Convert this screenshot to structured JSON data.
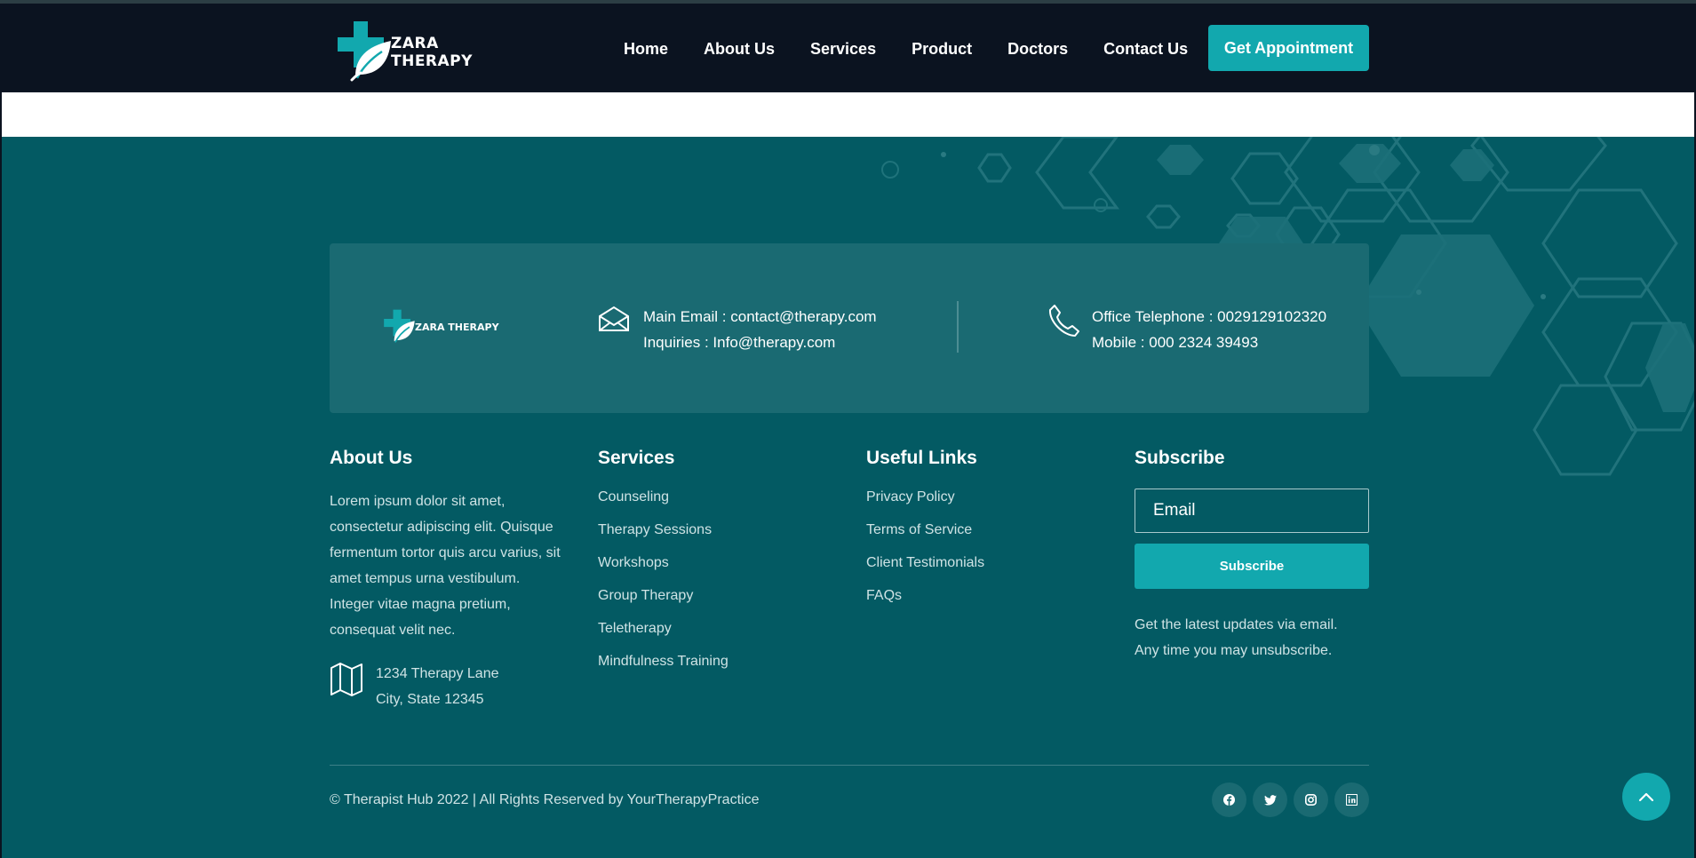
{
  "brand": {
    "name": "ZARA THERAPY",
    "accent_color": "#12a8ae",
    "nav_bg": "#0b1320",
    "footer_bg": "#035a63"
  },
  "nav": {
    "items": [
      {
        "label": "Home"
      },
      {
        "label": "About Us"
      },
      {
        "label": "Services"
      },
      {
        "label": "Product"
      },
      {
        "label": "Doctors"
      },
      {
        "label": "Contact Us"
      }
    ],
    "cta_label": "Get Appointment"
  },
  "contact": {
    "logo_text": "ZARA THERAPY",
    "mail_icon": "envelope-icon",
    "main_email": "Main Email : contact@therapy.com",
    "inquiries": "Inquiries : Info@therapy.com",
    "phone_icon": "phone-icon",
    "office_phone": "Office Telephone : 0029129102320",
    "mobile": "Mobile : 000 2324 39493"
  },
  "about": {
    "heading": "About Us",
    "text": "Lorem ipsum dolor sit amet, consectetur adipiscing elit. Quisque fermentum tortor quis arcu varius, sit amet tempus urna vestibulum. Integer vitae magna pretium, consequat velit nec.",
    "address_icon": "map-icon",
    "address_line1": "1234 Therapy Lane",
    "address_line2": "City, State 12345"
  },
  "services": {
    "heading": "Services",
    "items": [
      "Counseling",
      "Therapy Sessions",
      "Workshops",
      "Group Therapy",
      "Teletherapy",
      "Mindfulness Training"
    ]
  },
  "useful_links": {
    "heading": "Useful Links",
    "items": [
      "Privacy Policy",
      "Terms of Service",
      "Client Testimonials",
      "FAQs"
    ]
  },
  "subscribe": {
    "heading": "Subscribe",
    "email_placeholder": "Email",
    "button_label": "Subscribe",
    "note_line1": "Get the latest updates via email.",
    "note_line2": "Any time you may unsubscribe."
  },
  "footer_bottom": {
    "copyright": "© Therapist Hub 2022 | All Rights Reserved by YourTherapyPractice",
    "socials": [
      "facebook-icon",
      "twitter-icon",
      "instagram-icon",
      "linkedin-icon"
    ],
    "scroll_top_icon": "chevron-up-icon"
  }
}
